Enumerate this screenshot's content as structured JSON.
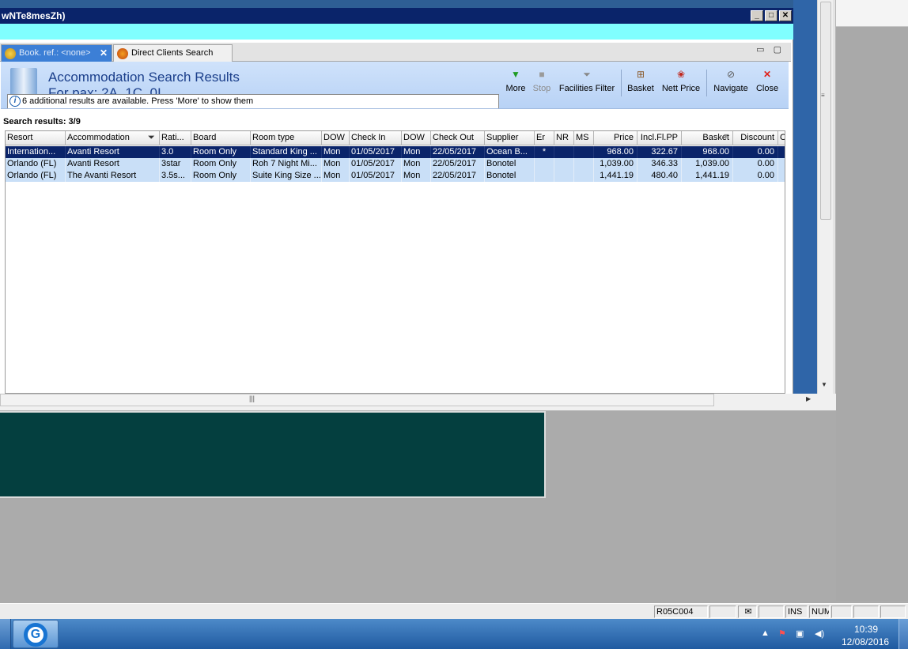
{
  "window": {
    "title": "wNTe8mesZh)",
    "controls": [
      "_",
      "□",
      "✕"
    ]
  },
  "tabs": [
    {
      "label": "Book. ref.: <none>"
    },
    {
      "label": "Direct Clients Search"
    }
  ],
  "header": {
    "title": "Accommodation Search Results",
    "subtitle": "For pax: 2A, 1C, 0I",
    "info_message": "6 additional results are available. Press 'More' to show them"
  },
  "toolbar": {
    "more": "More",
    "stop": "Stop",
    "facilities_filter": "Facilities Filter",
    "basket": "Basket",
    "nett_price": "Nett Price",
    "navigate": "Navigate",
    "close": "Close"
  },
  "results_label": "Search results: 3/9",
  "table": {
    "columns": [
      "Resort",
      "Accommodation",
      "Rati...",
      "Board",
      "Room type",
      "DOW",
      "Check In",
      "DOW",
      "Check Out",
      "Supplier",
      "Er",
      "NR",
      "MS",
      "Price",
      "Incl.Fl.PP",
      "Basket",
      "Discount",
      "C"
    ],
    "rows": [
      [
        "Internation...",
        "Avanti Resort",
        "3.0",
        "Room Only",
        "Standard King ...",
        "Mon",
        "01/05/2017",
        "Mon",
        "22/05/2017",
        "Ocean B...",
        "*",
        "",
        "",
        "968.00",
        "322.67",
        "968.00",
        "0.00",
        ""
      ],
      [
        "Orlando (FL)",
        "Avanti Resort",
        "3star",
        "Room Only",
        "Roh 7 Night Mi...",
        "Mon",
        "01/05/2017",
        "Mon",
        "22/05/2017",
        "Bonotel",
        "",
        "",
        "",
        "1,039.00",
        "346.33",
        "1,039.00",
        "0.00",
        ""
      ],
      [
        "Orlando (FL)",
        "The Avanti Resort",
        "3.5s...",
        "Room Only",
        "Suite King Size ...",
        "Mon",
        "01/05/2017",
        "Mon",
        "22/05/2017",
        "Bonotel",
        "",
        "",
        "",
        "1,441.19",
        "480.40",
        "1,441.19",
        "0.00",
        ""
      ]
    ]
  },
  "statusbar": {
    "code": "R05C004",
    "ins": "INS",
    "num": "NUM"
  },
  "taskbar": {
    "time": "10:39",
    "date": "12/08/2016"
  },
  "colors": {
    "selected_row": "#0a246a",
    "row_bg": "#c9dff7",
    "header_title": "#1b3f8b",
    "cyan_bar": "#80ffff"
  }
}
